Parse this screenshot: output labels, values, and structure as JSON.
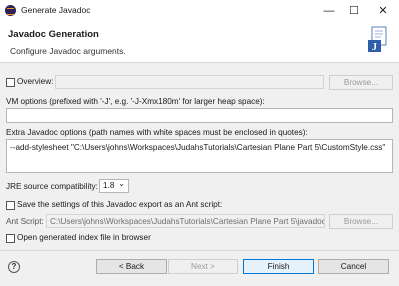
{
  "window": {
    "title": "Generate Javadoc",
    "minimize": "—",
    "maximize": "☐",
    "close": "✕"
  },
  "header": {
    "title": "Javadoc Generation",
    "message": "Configure Javadoc arguments."
  },
  "overview": {
    "label": "Overview:",
    "value": "",
    "browse": "Browse..."
  },
  "vm_options": {
    "label": "VM options (prefixed with '-J', e.g. '-J-Xmx180m' for larger heap space):",
    "value": ""
  },
  "extra_options": {
    "label": "Extra Javadoc options (path names with white spaces must be enclosed in quotes):",
    "value": "--add-stylesheet \"C:\\Users\\johns\\Workspaces\\JudahsTutorials\\Cartesian Plane Part 5\\CustomStyle.css\""
  },
  "jre": {
    "label": "JRE source compatibility:",
    "value": "1.8",
    "arrow": "⌄"
  },
  "ant": {
    "save_label": "Save the settings of this Javadoc export as an Ant script:",
    "script_label": "Ant Script:",
    "script_value": "C:\\Users\\johns\\Workspaces\\JudahsTutorials\\Cartesian Plane Part 5\\javadoc",
    "browse": "Browse..."
  },
  "open_index": {
    "label": "Open generated index file in browser"
  },
  "footer": {
    "help": "?",
    "back": "< Back",
    "next": "Next >",
    "finish": "Finish",
    "cancel": "Cancel"
  },
  "colors": {
    "accent": "#0078d7",
    "window_bg": "#f0f0f0",
    "header_bg": "#ffffff"
  }
}
